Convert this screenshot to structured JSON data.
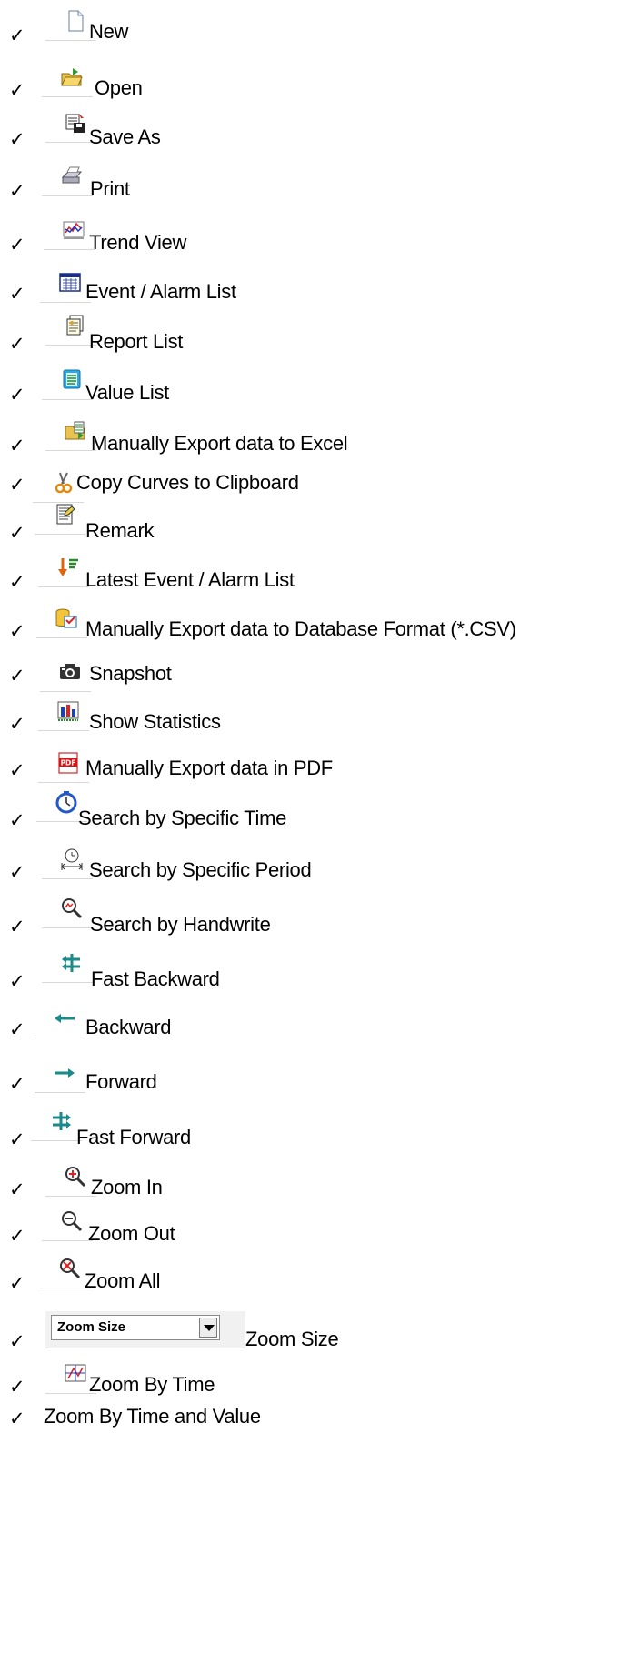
{
  "items": [
    {
      "label": "New",
      "icon": "new-file-icon"
    },
    {
      "label": "Open",
      "icon": "open-folder-icon"
    },
    {
      "label": "Save As",
      "icon": "save-as-icon"
    },
    {
      "label": "Print",
      "icon": "print-icon"
    },
    {
      "label": "Trend View",
      "icon": "trend-view-icon"
    },
    {
      "label": "Event / Alarm List",
      "icon": "event-alarm-list-icon"
    },
    {
      "label": "Report List",
      "icon": "report-list-icon"
    },
    {
      "label": "Value List",
      "icon": "value-list-icon"
    },
    {
      "label": "Manually Export data to Excel",
      "icon": "export-excel-icon"
    },
    {
      "label": "Copy Curves to Clipboard",
      "icon": "scissors-icon"
    },
    {
      "label": "Remark",
      "icon": "remark-icon"
    },
    {
      "label": "Latest Event / Alarm List",
      "icon": "latest-event-icon"
    },
    {
      "label": "Manually Export data to Database Format (*.CSV)",
      "icon": "export-csv-icon"
    },
    {
      "label": "Snapshot",
      "icon": "camera-icon"
    },
    {
      "label": "Show Statistics",
      "icon": "statistics-icon"
    },
    {
      "label": "Manually Export data in PDF",
      "icon": "pdf-icon"
    },
    {
      "label": "Search by Specific Time",
      "icon": "stopwatch-icon"
    },
    {
      "label": "Search by Specific Period",
      "icon": "period-clock-icon"
    },
    {
      "label": "Search by Handwrite",
      "icon": "handwrite-search-icon"
    },
    {
      "label": "Fast Backward",
      "icon": "fast-backward-icon"
    },
    {
      "label": "Backward",
      "icon": "backward-icon"
    },
    {
      "label": "Forward",
      "icon": "forward-icon"
    },
    {
      "label": "Fast Forward",
      "icon": "fast-forward-icon"
    },
    {
      "label": "Zoom In",
      "icon": "zoom-in-icon"
    },
    {
      "label": "Zoom Out",
      "icon": "zoom-out-icon"
    },
    {
      "label": "Zoom All",
      "icon": "zoom-all-icon"
    },
    {
      "label": "Zoom Size",
      "icon": "zoom-size-combo",
      "combo_value": "Zoom Size"
    },
    {
      "label": "Zoom By Time",
      "icon": "zoom-by-time-icon"
    },
    {
      "label": "Zoom By Time and Value",
      "icon": ""
    }
  ],
  "check_glyph": "✓"
}
